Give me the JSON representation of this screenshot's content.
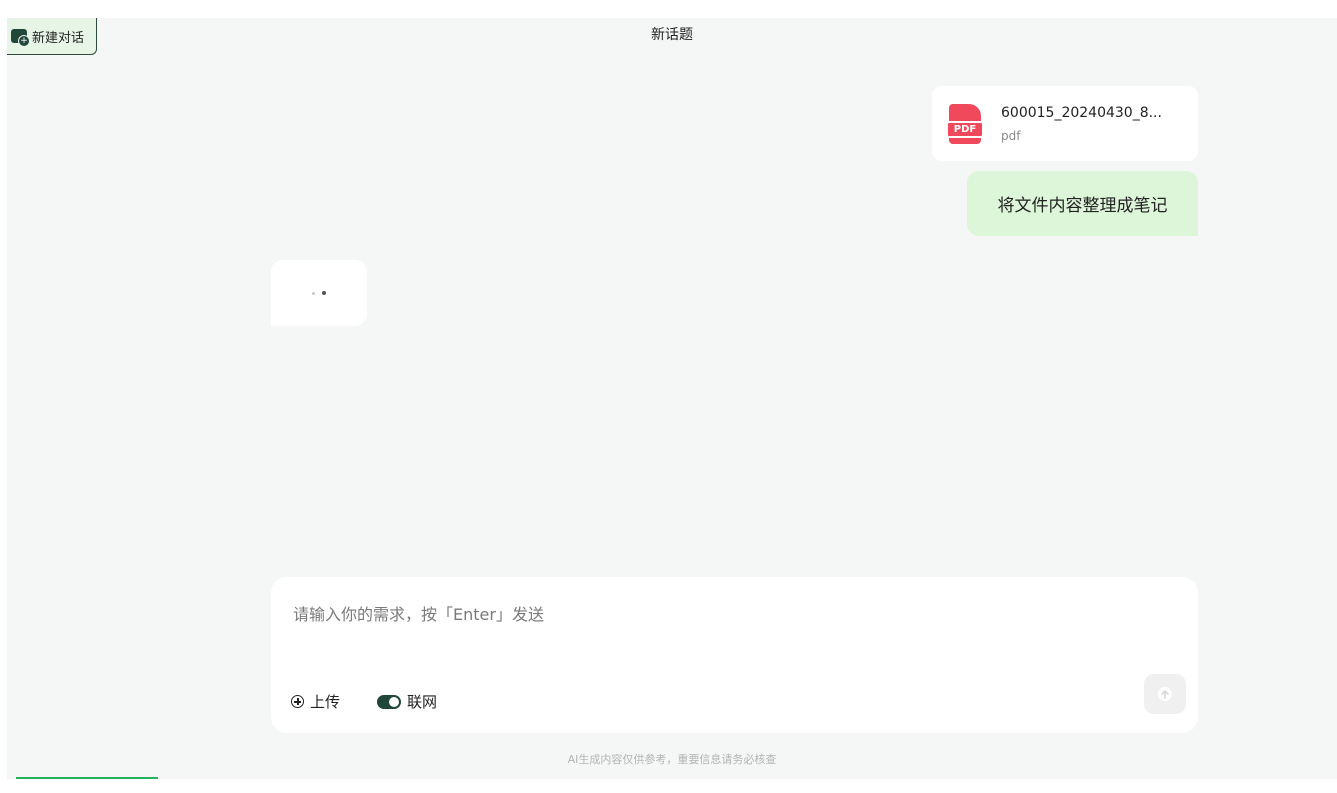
{
  "header": {
    "new_chat_label": "新建对话",
    "topic_title": "新话题"
  },
  "conversation": {
    "attachment": {
      "file_name": "600015_20240430_8...",
      "file_type": "pdf",
      "badge": "PDF"
    },
    "user_message": "将文件内容整理成笔记",
    "assistant_status": "loading"
  },
  "composer": {
    "placeholder": "请输入你的需求，按「Enter」发送",
    "value": "",
    "upload_label": "上传",
    "web_label": "联网",
    "web_enabled": true
  },
  "footer": {
    "disclaimer": "AI生成内容仅供参考，重要信息请务必核查"
  },
  "colors": {
    "accent": "#21463a",
    "user_bubble": "#ddf5d9",
    "pdf_red": "#f0495c",
    "progress_green": "#27b35d"
  }
}
